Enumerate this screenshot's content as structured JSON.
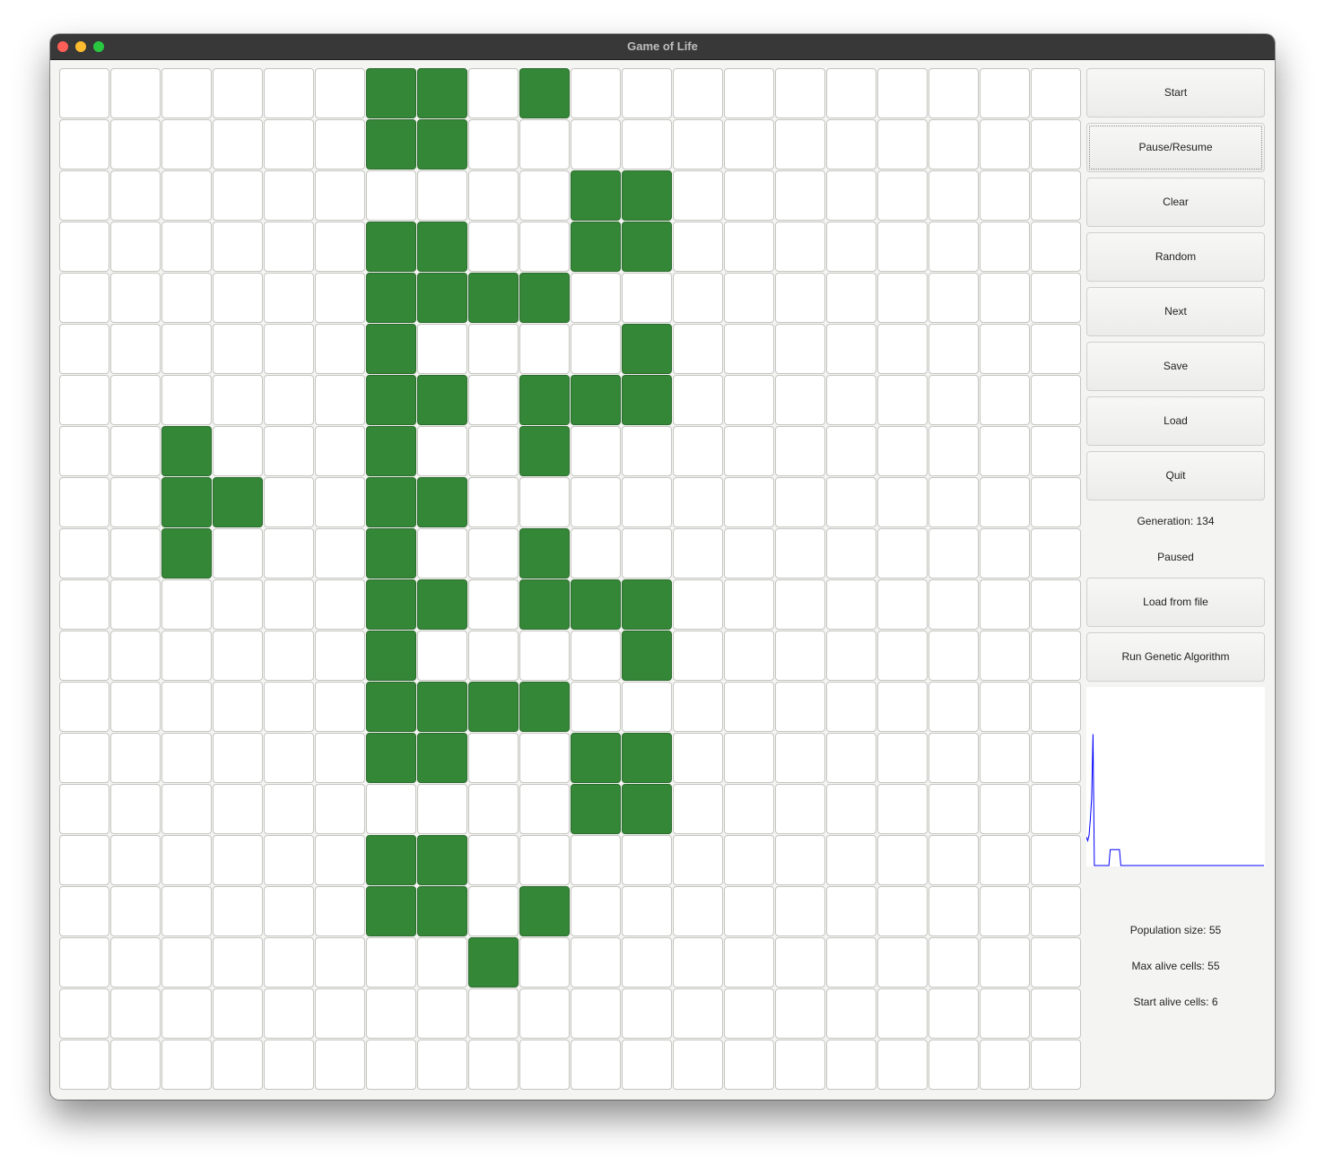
{
  "window": {
    "title": "Game of Life"
  },
  "grid": {
    "rows": 20,
    "cols": 20,
    "alive_color": "#358738",
    "dead_color": "#ffffff",
    "alive_cells": [
      [
        0,
        6
      ],
      [
        0,
        7
      ],
      [
        0,
        9
      ],
      [
        1,
        6
      ],
      [
        1,
        7
      ],
      [
        2,
        10
      ],
      [
        2,
        11
      ],
      [
        3,
        6
      ],
      [
        3,
        7
      ],
      [
        3,
        10
      ],
      [
        3,
        11
      ],
      [
        4,
        6
      ],
      [
        4,
        7
      ],
      [
        4,
        8
      ],
      [
        4,
        9
      ],
      [
        5,
        6
      ],
      [
        5,
        11
      ],
      [
        6,
        6
      ],
      [
        6,
        7
      ],
      [
        6,
        9
      ],
      [
        6,
        10
      ],
      [
        6,
        11
      ],
      [
        7,
        2
      ],
      [
        7,
        6
      ],
      [
        7,
        9
      ],
      [
        8,
        2
      ],
      [
        8,
        3
      ],
      [
        8,
        6
      ],
      [
        8,
        7
      ],
      [
        9,
        2
      ],
      [
        9,
        6
      ],
      [
        9,
        9
      ],
      [
        10,
        6
      ],
      [
        10,
        7
      ],
      [
        10,
        9
      ],
      [
        10,
        10
      ],
      [
        10,
        11
      ],
      [
        11,
        6
      ],
      [
        11,
        11
      ],
      [
        12,
        6
      ],
      [
        12,
        7
      ],
      [
        12,
        8
      ],
      [
        12,
        9
      ],
      [
        13,
        6
      ],
      [
        13,
        7
      ],
      [
        13,
        10
      ],
      [
        13,
        11
      ],
      [
        14,
        10
      ],
      [
        14,
        11
      ],
      [
        15,
        6
      ],
      [
        15,
        7
      ],
      [
        16,
        6
      ],
      [
        16,
        7
      ],
      [
        16,
        9
      ],
      [
        17,
        8
      ]
    ]
  },
  "controls": {
    "start": "Start",
    "pause_resume": "Pause/Resume",
    "clear": "Clear",
    "random": "Random",
    "next": "Next",
    "save": "Save",
    "load": "Load",
    "quit": "Quit",
    "generation": "Generation: 134",
    "status": "Paused",
    "load_from_file": "Load from file",
    "run_genetic_algorithm": "Run Genetic Algorithm"
  },
  "chart_data": {
    "type": "line",
    "title": "",
    "xlabel": "",
    "ylabel": "",
    "line_color": "#0000ff",
    "x": [
      0,
      1,
      2,
      3,
      4,
      5,
      6,
      7,
      8,
      9,
      10,
      11,
      12,
      13,
      14,
      15,
      16,
      17,
      18,
      19,
      20,
      21,
      22,
      23,
      24,
      25,
      26,
      27,
      28,
      29,
      30,
      31,
      32,
      33,
      34,
      35,
      36,
      37,
      38,
      39,
      40,
      41,
      42,
      43,
      44,
      45,
      46,
      47,
      48,
      49,
      50,
      51,
      52,
      53,
      54,
      55,
      56,
      57,
      58,
      59,
      60,
      61,
      62,
      63,
      64,
      65,
      66,
      67,
      68,
      69,
      70,
      71,
      72,
      73,
      74,
      75,
      76,
      77,
      78,
      79,
      80,
      81,
      82,
      83,
      84,
      85,
      86,
      87,
      88,
      89,
      90,
      91,
      92,
      93,
      94,
      95,
      96,
      97,
      98,
      99,
      100,
      101,
      102,
      103,
      104,
      105,
      106,
      107,
      108,
      109,
      110,
      111,
      112,
      113,
      114,
      115,
      116,
      117,
      118,
      119,
      120,
      121,
      122,
      123,
      124,
      125,
      126,
      127,
      128,
      129,
      130,
      131,
      132,
      133,
      134
    ],
    "values": [
      16,
      14,
      17,
      26,
      38,
      74,
      0,
      0,
      0,
      0,
      0,
      0,
      0,
      0,
      0,
      0,
      0,
      0,
      9,
      9,
      9,
      9,
      9,
      9,
      9,
      9,
      0,
      0,
      0,
      0,
      0,
      0,
      0,
      0,
      0,
      0,
      0,
      0,
      0,
      0,
      0,
      0,
      0,
      0,
      0,
      0,
      0,
      0,
      0,
      0,
      0,
      0,
      0,
      0,
      0,
      0,
      0,
      0,
      0,
      0,
      0,
      0,
      0,
      0,
      0,
      0,
      0,
      0,
      0,
      0,
      0,
      0,
      0,
      0,
      0,
      0,
      0,
      0,
      0,
      0,
      0,
      0,
      0,
      0,
      0,
      0,
      0,
      0,
      0,
      0,
      0,
      0,
      0,
      0,
      0,
      0,
      0,
      0,
      0,
      0,
      0,
      0,
      0,
      0,
      0,
      0,
      0,
      0,
      0,
      0,
      0,
      0,
      0,
      0,
      0,
      0,
      0,
      0,
      0,
      0,
      0,
      0,
      0,
      0,
      0,
      0,
      0,
      0,
      0,
      0,
      0,
      0,
      0,
      0,
      0,
      0
    ],
    "ylim": [
      0,
      100
    ]
  },
  "stats": {
    "population_size": "Population size: 55",
    "max_alive_cells": "Max alive cells: 55",
    "start_alive_cells": "Start alive cells: 6"
  }
}
